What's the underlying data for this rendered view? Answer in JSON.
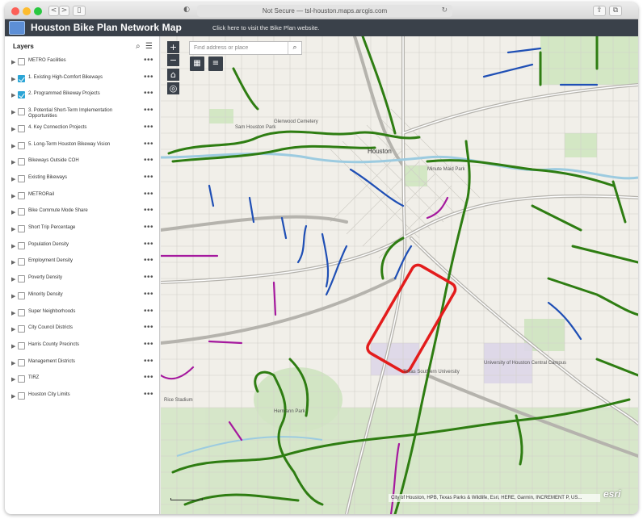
{
  "browser": {
    "url": "Not Secure — tsl-houston.maps.arcgis.com",
    "back": "<",
    "forward": ">",
    "sidebar_toggle": "▯",
    "shield": "◐",
    "reload": "↻",
    "share": "⇪",
    "tabs": "⧉"
  },
  "app": {
    "title": "Houston Bike Plan Network Map",
    "link": "Click here to visit the Bike Plan website."
  },
  "sidebar": {
    "heading": "Layers",
    "search_icon": "⌕",
    "filter_icon": "☰",
    "layers": [
      {
        "label": "METRO Facilities",
        "checked": false
      },
      {
        "label": "1. Existing High-Comfort Bikeways",
        "checked": true
      },
      {
        "label": "2. Programmed Bikeway Projects",
        "checked": true
      },
      {
        "label": "3. Potential Short-Term Implementation Opportunities",
        "checked": false
      },
      {
        "label": "4. Key Connection Projects",
        "checked": false
      },
      {
        "label": "5. Long-Term Houston Bikeway Vision",
        "checked": false
      },
      {
        "label": "Bikeways Outside COH",
        "checked": false
      },
      {
        "label": "Existing Bikeways",
        "checked": false
      },
      {
        "label": "METRORail",
        "checked": false
      },
      {
        "label": "Bike Commute Mode Share",
        "checked": false
      },
      {
        "label": "Short Trip Percentage",
        "checked": false
      },
      {
        "label": "Population Density",
        "checked": false
      },
      {
        "label": "Employment Density",
        "checked": false
      },
      {
        "label": "Poverty Density",
        "checked": false
      },
      {
        "label": "Minority Density",
        "checked": false
      },
      {
        "label": "Super Neighborhoods",
        "checked": false
      },
      {
        "label": "City Council Districts",
        "checked": false
      },
      {
        "label": "Harris County Precincts",
        "checked": false
      },
      {
        "label": "Management Districts",
        "checked": false
      },
      {
        "label": "TIRZ",
        "checked": false
      },
      {
        "label": "Houston City Limits",
        "checked": false
      }
    ],
    "more_icon": "•••",
    "collapse": "‹"
  },
  "map": {
    "zoom_in": "+",
    "zoom_out": "−",
    "home_icon": "⌂",
    "locate_icon": "◎",
    "search_placeholder": "Find address or place",
    "search_button": "⌕",
    "basemap_icon": "▦",
    "legend_icon": "≡",
    "places": {
      "houston": "Houston",
      "sam_houston_park": "Sam Houston Park",
      "glenwood_cemetery": "Glenwood Cemetery",
      "minute_maid_park": "Minute Maid Park",
      "texas_southern_university": "Texas Southern University",
      "university_of_houston": "University of Houston Central Campus",
      "hermann_park": "Hermann Park",
      "rice_stadium": "Rice Stadium"
    },
    "attribution": "City of Houston, HPB, Texas Parks & Wildlife, Esri, HERE, Garmin, INCREMENT P, US...",
    "esri_logo": "esri",
    "colors": {
      "existing_high_comfort": "#2e7d12",
      "programmed": "#1f4fb5",
      "vision": "#a5199e",
      "highlight": "#e31c1c"
    }
  }
}
